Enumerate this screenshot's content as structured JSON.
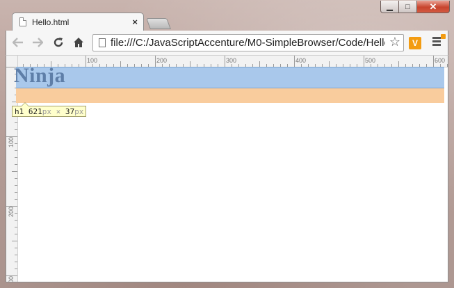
{
  "window": {
    "minimize_symbol": "▁",
    "maximize_symbol": "□",
    "close_symbol": "✕"
  },
  "tabs": [
    {
      "title": "Hello.html",
      "close_symbol": "×"
    }
  ],
  "toolbar": {
    "back_icon": "arrow-left-icon",
    "forward_icon": "arrow-right-icon",
    "reload_icon": "reload-icon",
    "home_icon": "home-icon",
    "url": "file:///C:/JavaScriptAccenture/M0-SimpleBrowser/Code/Hello.html",
    "bookmark_star": "☆",
    "extension_label": "V"
  },
  "rulers": {
    "top_labels": [
      "100",
      "200",
      "300",
      "400",
      "500",
      "600"
    ],
    "left_labels": [
      "100",
      "200",
      "300"
    ]
  },
  "page": {
    "h1_text": "Ninja"
  },
  "inspector_tooltip": {
    "tag": "h1",
    "width_value": "621",
    "width_unit": "px",
    "separator": "×",
    "height_value": "37",
    "height_unit": "px"
  },
  "colors": {
    "content_highlight": "#a9c8eb",
    "margin_highlight": "#f9cc9d",
    "tooltip_bg": "#ffffcc",
    "extension_accent": "#f39c12"
  }
}
